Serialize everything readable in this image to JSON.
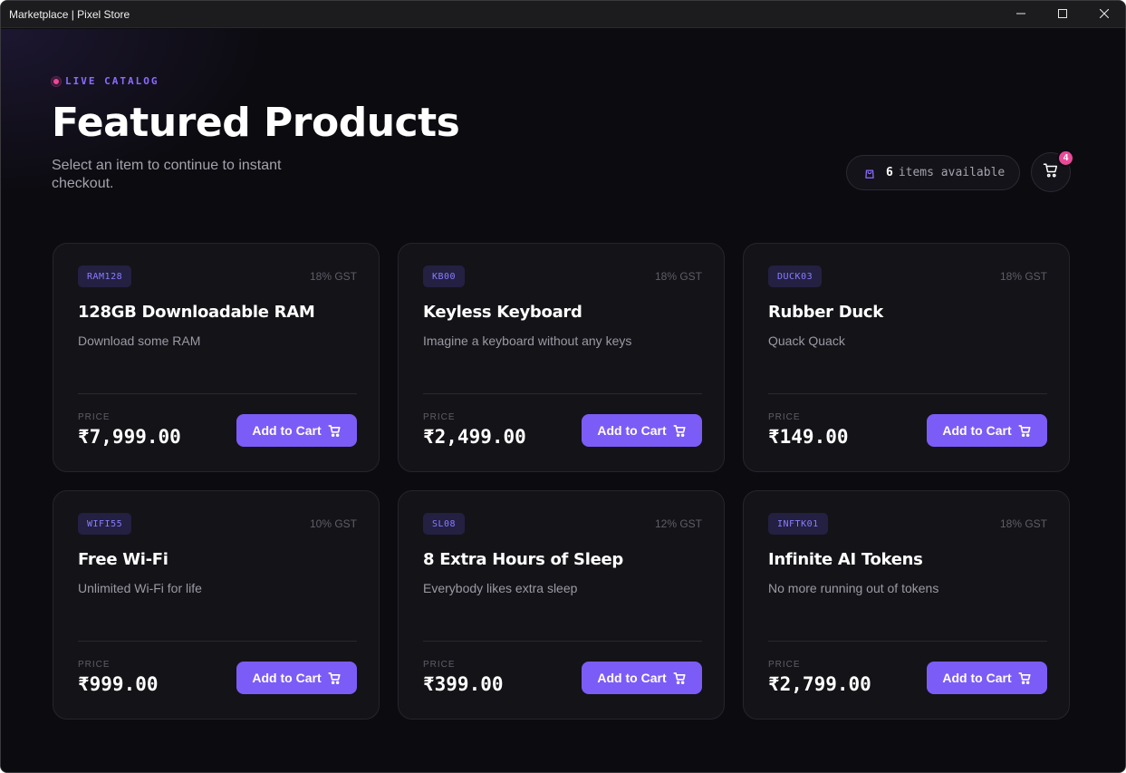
{
  "window": {
    "title": "Marketplace | Pixel Store",
    "controls": {
      "minimize": "minimize-icon",
      "maximize": "maximize-icon",
      "close": "close-icon"
    }
  },
  "header": {
    "live_label": "LIVE CATALOG",
    "title": "Featured Products",
    "subtitle": "Select an item to continue to instant checkout.",
    "available_count": "6",
    "available_label": "items available",
    "cart_badge": "4"
  },
  "card_labels": {
    "price_label": "PRICE",
    "add_to_cart": "Add to Cart"
  },
  "products": [
    {
      "sku": "RAM128",
      "gst": "18% GST",
      "name": "128GB Downloadable RAM",
      "description": "Download some RAM",
      "price": "₹7,999.00"
    },
    {
      "sku": "KB00",
      "gst": "18% GST",
      "name": "Keyless Keyboard",
      "description": "Imagine a keyboard without any keys",
      "price": "₹2,499.00"
    },
    {
      "sku": "DUCK03",
      "gst": "18% GST",
      "name": "Rubber Duck",
      "description": "Quack Quack",
      "price": "₹149.00"
    },
    {
      "sku": "WIFI55",
      "gst": "10% GST",
      "name": "Free Wi-Fi",
      "description": "Unlimited Wi-Fi for life",
      "price": "₹999.00"
    },
    {
      "sku": "SL08",
      "gst": "12% GST",
      "name": "8 Extra Hours of Sleep",
      "description": "Everybody likes extra sleep",
      "price": "₹399.00"
    },
    {
      "sku": "INFTK01",
      "gst": "18% GST",
      "name": "Infinite AI Tokens",
      "description": "No more running out of tokens",
      "price": "₹2,799.00"
    }
  ],
  "colors": {
    "accent": "#7c5cf6",
    "badge": "#ec4899",
    "background": "#0c0b10",
    "card": "#141318"
  }
}
